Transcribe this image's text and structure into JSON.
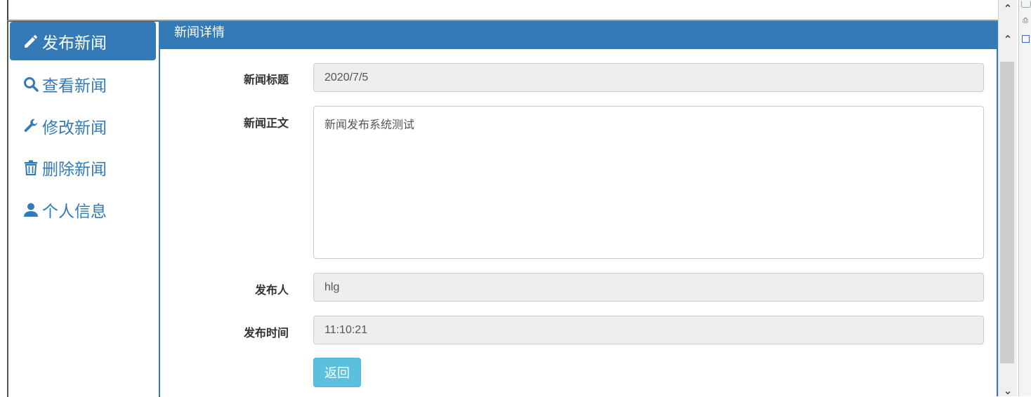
{
  "sidebar": {
    "items": [
      {
        "label": "发布新闻",
        "icon": "pencil-icon",
        "active": true
      },
      {
        "label": "查看新闻",
        "icon": "search-icon",
        "active": false
      },
      {
        "label": "修改新闻",
        "icon": "wrench-icon",
        "active": false
      },
      {
        "label": "删除新闻",
        "icon": "trash-icon",
        "active": false
      },
      {
        "label": "个人信息",
        "icon": "user-icon",
        "active": false
      }
    ]
  },
  "panel": {
    "title": "新闻详情",
    "fields": {
      "title_label": "新闻标题",
      "title_value": "2020/7/5",
      "body_label": "新闻正文",
      "body_value": "新闻发布系统测试",
      "author_label": "发布人",
      "author_value": "hlg",
      "time_label": "发布时间",
      "time_value": "11:10:21"
    },
    "back_button": "返回"
  },
  "colors": {
    "primary": "#337ab7",
    "info_button": "#5bc0de",
    "readonly_bg": "#eeeeee"
  }
}
